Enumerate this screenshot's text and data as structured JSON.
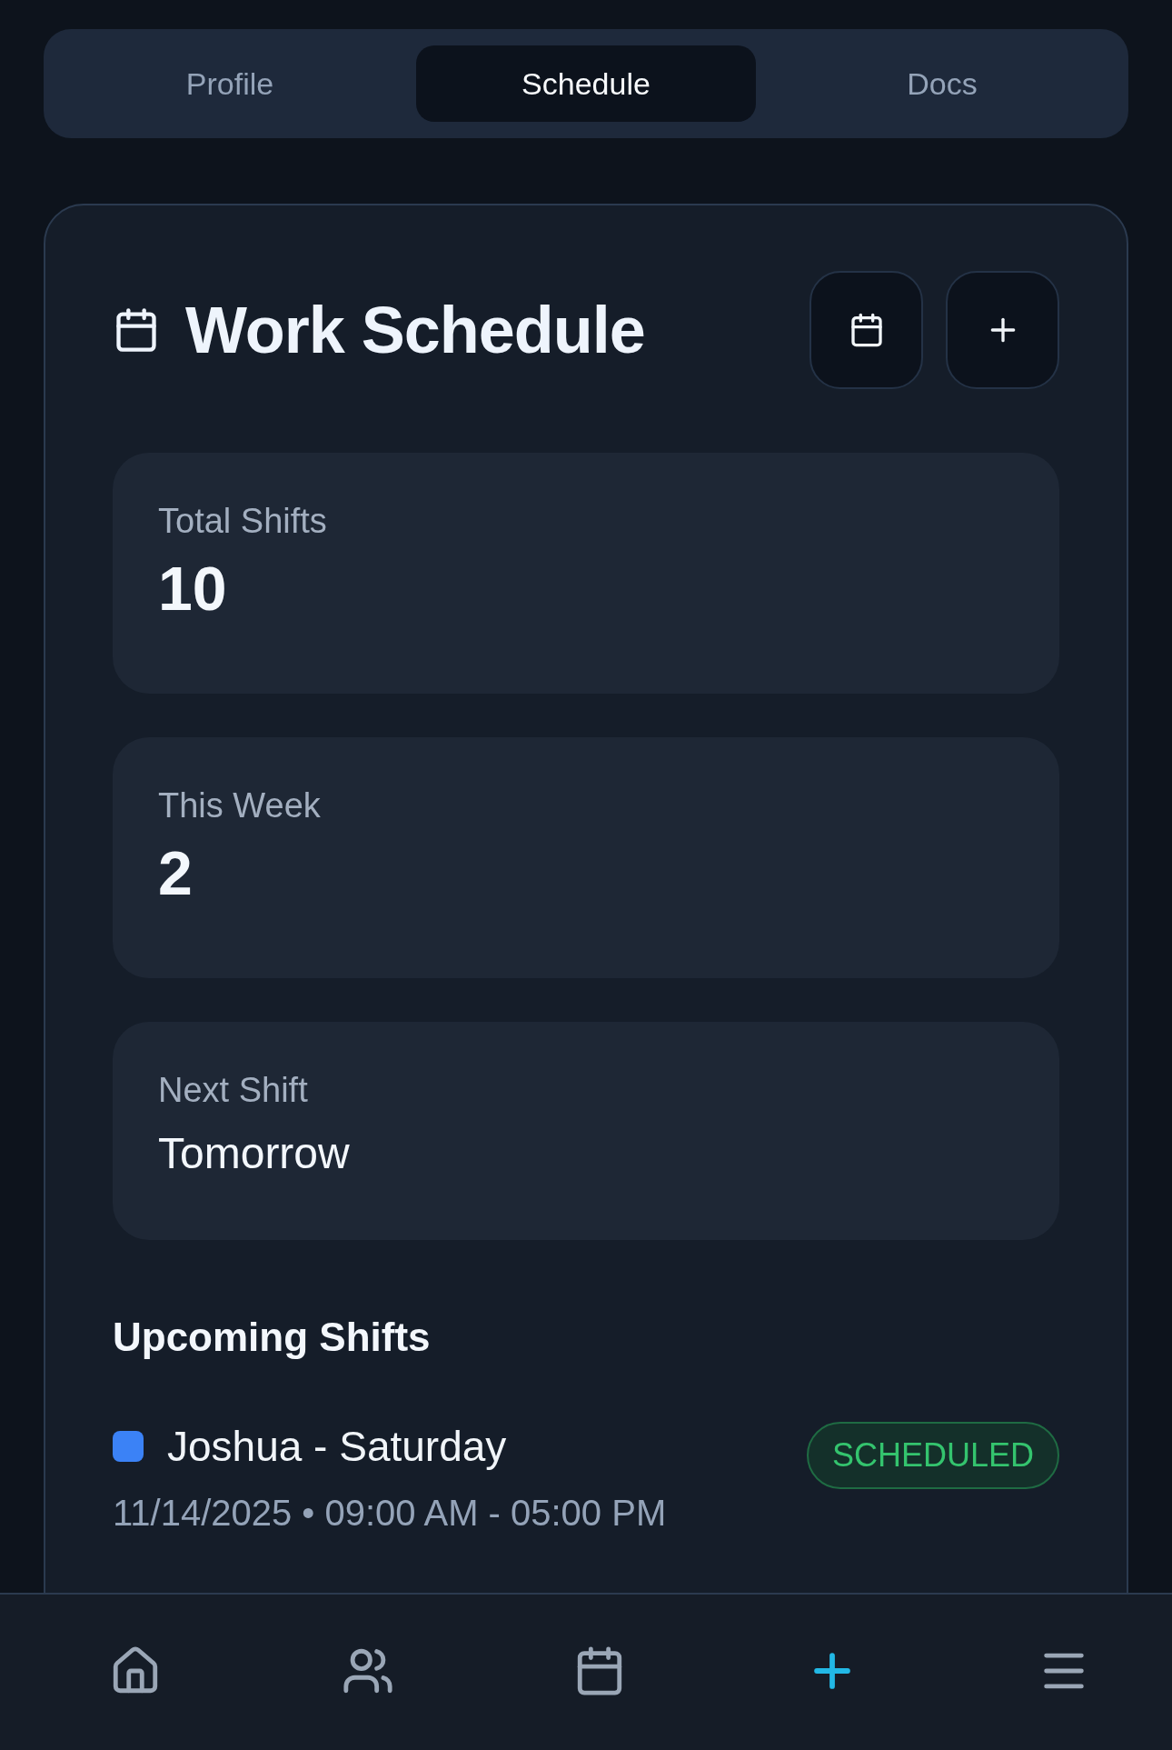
{
  "tabs": [
    {
      "label": "Profile",
      "selected": false
    },
    {
      "label": "Schedule",
      "selected": true
    },
    {
      "label": "Docs",
      "selected": false
    }
  ],
  "schedule": {
    "title": "Work Schedule",
    "stats": [
      {
        "label": "Total Shifts",
        "value": "10",
        "kind": "number"
      },
      {
        "label": "This Week",
        "value": "2",
        "kind": "number"
      },
      {
        "label": "Next Shift",
        "value": "Tomorrow",
        "kind": "text"
      }
    ],
    "section_title": "Upcoming Shifts",
    "shifts": [
      {
        "title": "Joshua - Saturday",
        "color": "#3b82f6",
        "details": "11/14/2025 • 09:00 AM - 05:00 PM",
        "status": {
          "label": "SCHEDULED",
          "kind": "scheduled"
        }
      }
    ]
  }
}
